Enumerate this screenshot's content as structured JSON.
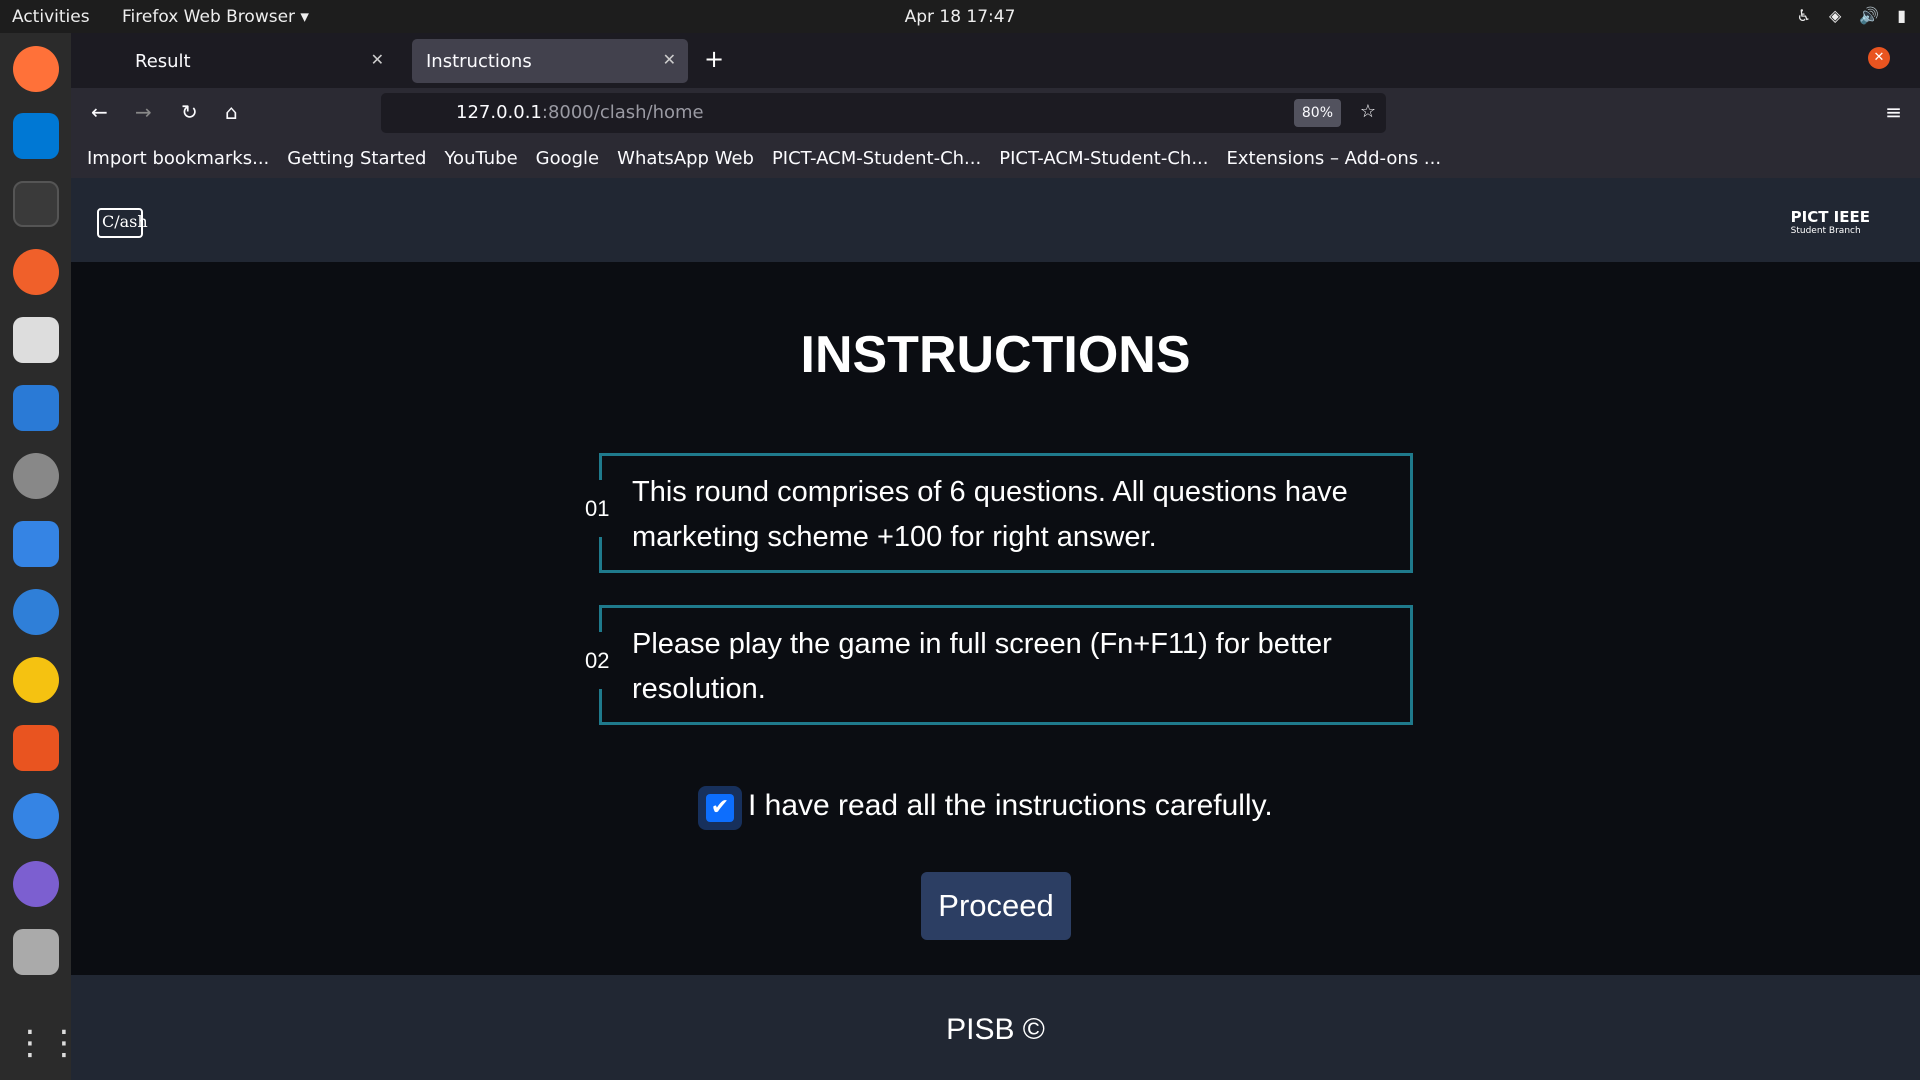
{
  "system": {
    "activities": "Activities",
    "app": "Firefox Web Browser ▾",
    "clock": "Apr 18  17:47"
  },
  "browser": {
    "tabs": [
      {
        "label": "Result",
        "active": false
      },
      {
        "label": "Instructions",
        "active": true
      }
    ],
    "url_host": "127.0.0.1",
    "url_path": ":8000/clash/home",
    "zoom": "80%",
    "bookmarks": [
      "Import bookmarks...",
      "Getting Started",
      "YouTube",
      "Google",
      "WhatsApp Web",
      "PICT-ACM-Student-Ch...",
      "PICT-ACM-Student-Ch...",
      "Extensions – Add-ons ..."
    ]
  },
  "header": {
    "logo": "C/ash",
    "brand": "PICT IEEE",
    "brand_sub": "Student Branch"
  },
  "main": {
    "title": "INSTRUCTIONS",
    "instructions": [
      {
        "num": "01",
        "text": "This round comprises of 6 questions. All questions have marketing scheme +100 for right answer."
      },
      {
        "num": "02",
        "text": "Please play the game in full screen (Fn+F11) for better resolution."
      }
    ],
    "checkbox_label": "I have read all the instructions carefully.",
    "checkbox_checked": true,
    "proceed": "Proceed"
  },
  "footer": {
    "text": "PISB ©"
  },
  "colors": {
    "border": "#1f7a8c",
    "button": "#2c3e63",
    "header": "#212733",
    "checkbox": "#0d6efd"
  }
}
